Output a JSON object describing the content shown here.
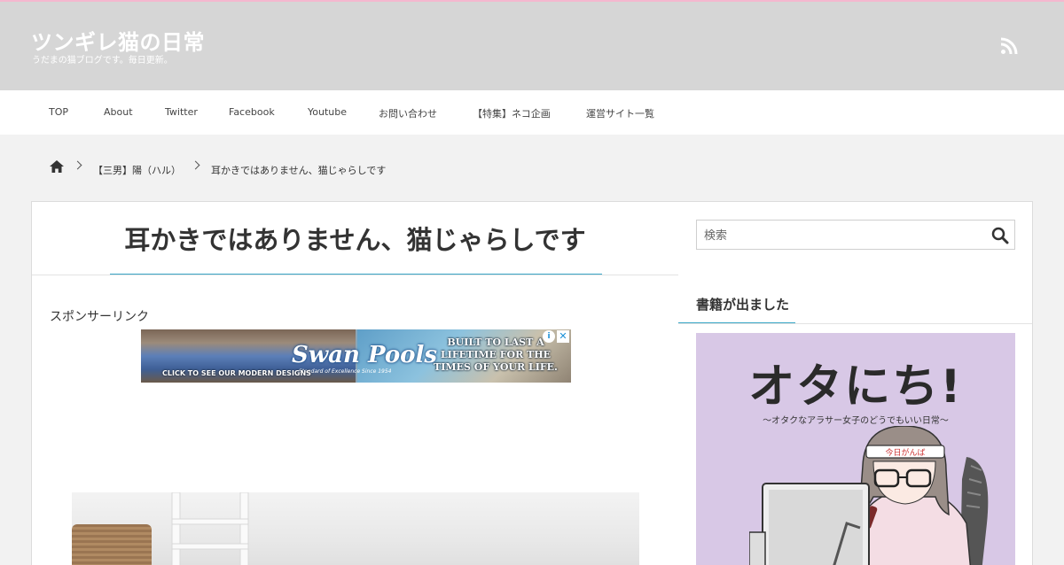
{
  "site": {
    "title": "ツンギレ猫の日常",
    "description": "うだまの猫ブログです。毎日更新。"
  },
  "icons": {
    "rss": "rss-icon",
    "home": "home-icon",
    "search": "search-icon"
  },
  "nav": {
    "items": [
      {
        "label": "TOP"
      },
      {
        "label": "About"
      },
      {
        "label": "Twitter"
      },
      {
        "label": "Facebook"
      },
      {
        "label": "Youtube"
      },
      {
        "label": "お問い合わせ"
      },
      {
        "label": "【特集】ネコ企画"
      },
      {
        "label": "運営サイト一覧"
      }
    ]
  },
  "breadcrumb": {
    "category": "【三男】陽（ハル）",
    "current": "耳かきではありません、猫じゃらしです"
  },
  "post": {
    "title": "耳かきではありません、猫じゃらしです",
    "sponsor_label": "スポンサーリンク"
  },
  "ad": {
    "brand": "Swan Pools",
    "brand_sub": "Standard of Excellence Since 1954",
    "tagline": "BUILT TO LAST A LIFETIME FOR THE TIMES OF YOUR LIFE.",
    "cta": "CLICK TO SEE OUR MODERN DESIGNS"
  },
  "sidebar": {
    "search_placeholder": "検索",
    "widget_title": "書籍が出ました",
    "book_title": "オタにち!",
    "book_subtitle": "〜オタクなアラサー女子のどうでもいい日常〜"
  },
  "colors": {
    "accent": "#3aa7c7",
    "header_bg": "#d6d6d6",
    "top_stripe": "#f4b8cf",
    "book_bg": "#d8c8e6"
  }
}
